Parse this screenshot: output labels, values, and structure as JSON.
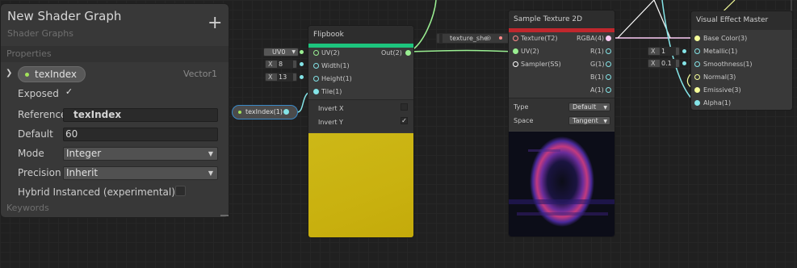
{
  "blackboard": {
    "title": "New Shader Graph",
    "subtitle": "Shader Graphs",
    "add_label": "+",
    "properties_header": "Properties",
    "keywords_header": "Keywords",
    "property": {
      "name": "texIndex",
      "type": "Vector1",
      "exposed_label": "Exposed",
      "exposed_checked": true,
      "reference_label": "Reference",
      "reference_value": "texIndex",
      "default_label": "Default",
      "default_value": "60",
      "mode_label": "Mode",
      "mode_value": "Integer",
      "precision_label": "Precision",
      "precision_value": "Inherit",
      "hybrid_label": "Hybrid Instanced (experimental)",
      "hybrid_checked": false
    }
  },
  "flipbook": {
    "title": "Flipbook",
    "accent": "#1dc57e",
    "inputs": [
      "UV(2)",
      "Width(1)",
      "Height(1)",
      "Tile(1)"
    ],
    "output": "Out(2)",
    "uv_chip": "UV0",
    "width_value": "8",
    "height_value": "13",
    "invert_x_label": "Invert X",
    "invert_x_checked": false,
    "invert_y_label": "Invert Y",
    "invert_y_checked": true,
    "preview_color": "#c9b10f"
  },
  "property_node": {
    "label": "texIndex(1)"
  },
  "sample_texture": {
    "title": "Sample Texture 2D",
    "accent": "#c0272d",
    "inputs": [
      "Texture(T2)",
      "UV(2)",
      "Sampler(SS)"
    ],
    "outputs": [
      "RGBA(4)",
      "R(1)",
      "G(1)",
      "B(1)",
      "A(1)"
    ],
    "texture_chip": "texture_she",
    "type_label": "Type",
    "type_value": "Default",
    "space_label": "Space",
    "space_value": "Tangent"
  },
  "master": {
    "title": "Visual Effect Master",
    "inputs": [
      "Base Color(3)",
      "Metallic(1)",
      "Smoothness(1)",
      "Normal(3)",
      "Emissive(3)",
      "Alpha(1)"
    ],
    "metallic_value": "1",
    "smoothness_value": "0.1"
  },
  "colors": {
    "vector1": "#84e4e7",
    "vector2": "#9aef92",
    "vector3": "#f6ff9a",
    "vector4": "#fbcbf4",
    "texture": "#ff8b8b",
    "sampler": "#ffffff",
    "selection": "#3a88c6"
  }
}
